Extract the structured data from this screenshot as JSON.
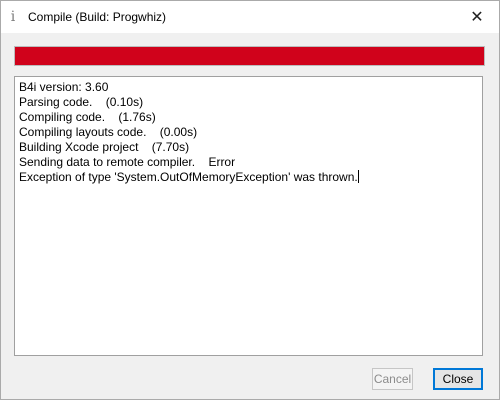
{
  "window": {
    "title": "Compile (Build: Progwhiz)",
    "app_icon_glyph": "i",
    "app_icon": "info-icon",
    "close_glyph": "✕",
    "close_icon": "close-icon"
  },
  "progress": {
    "value_percent": 100,
    "fill_color": "#d0021b",
    "status": "error"
  },
  "log": {
    "lines": [
      "B4i version: 3.60",
      "Parsing code.    (0.10s)",
      "Compiling code.    (1.76s)",
      "Compiling layouts code.    (0.00s)",
      "Building Xcode project    (7.70s)",
      "Sending data to remote compiler.    Error",
      "Exception of type 'System.OutOfMemoryException' was thrown."
    ]
  },
  "buttons": {
    "cancel_label": "Cancel",
    "cancel_enabled": false,
    "close_label": "Close"
  },
  "colors": {
    "accent_focus": "#0078d7",
    "error_red": "#d0021b"
  }
}
